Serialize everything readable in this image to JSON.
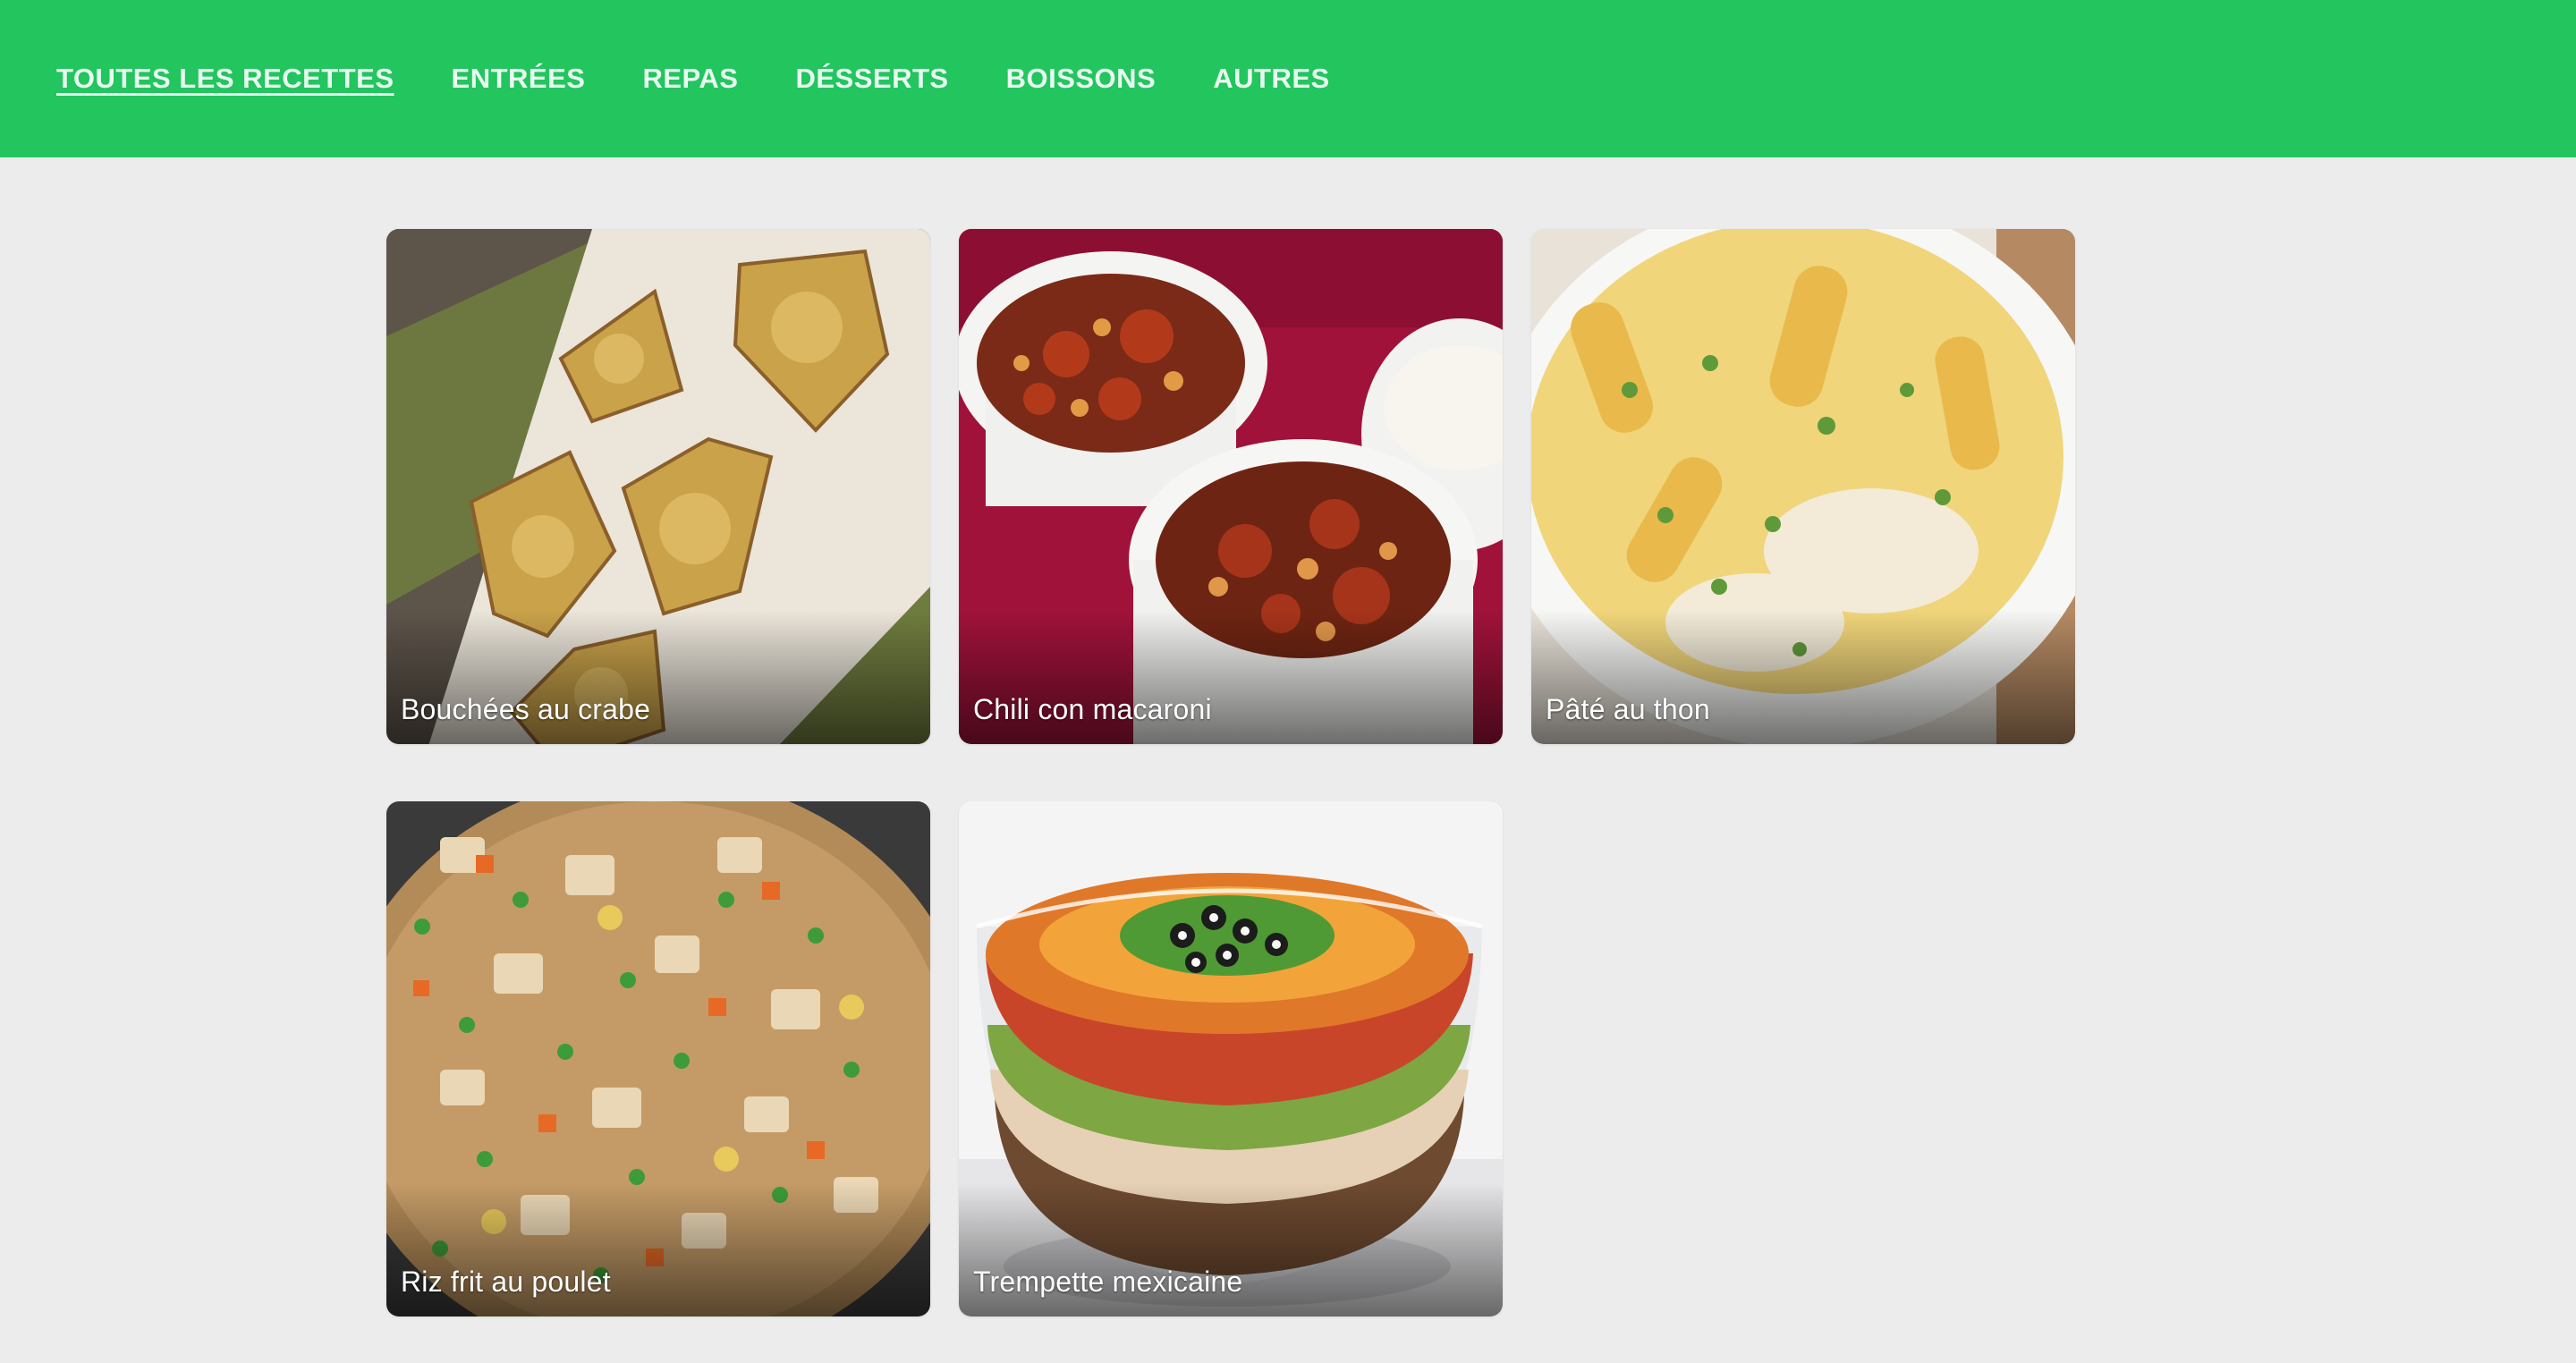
{
  "nav": {
    "items": [
      {
        "label": "TOUTES LES RECETTES"
      },
      {
        "label": "ENTRÉES"
      },
      {
        "label": "REPAS"
      },
      {
        "label": "DÉSSERTS"
      },
      {
        "label": "BOISSONS"
      },
      {
        "label": "AUTRES"
      }
    ]
  },
  "recipes": [
    {
      "title": "Bouchées au crabe"
    },
    {
      "title": "Chili con macaroni"
    },
    {
      "title": "Pâté au thon"
    },
    {
      "title": "Riz frit au poulet"
    },
    {
      "title": "Trempette mexicaine"
    }
  ],
  "colors": {
    "header": "#22c55e",
    "page_background": "#ececec",
    "nav_text": "#e9fbf0"
  }
}
